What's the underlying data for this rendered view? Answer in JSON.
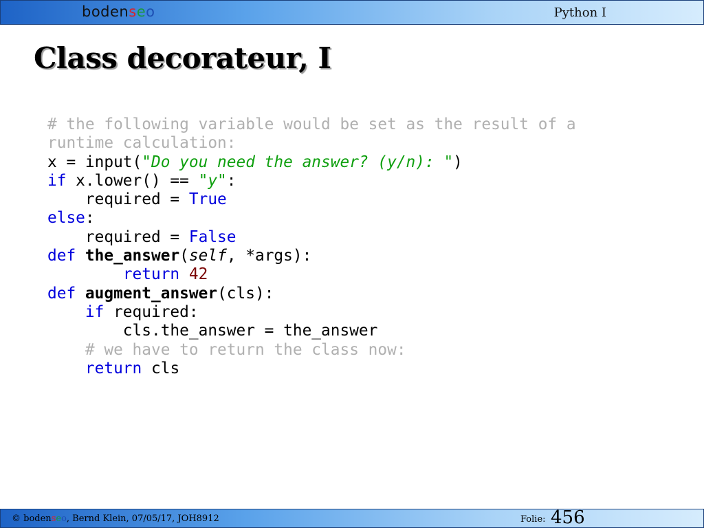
{
  "header": {
    "logo_text": "bodenseo",
    "course_title": "Python I"
  },
  "slide": {
    "title": "Class decorateur, I"
  },
  "code": {
    "comment_1a": "# the following variable would be set as the result of a",
    "comment_1b": "runtime calculation:",
    "line_x_prefix": "x = input(",
    "line_x_string": "\"Do you need the answer? (y/n): \"",
    "line_x_suffix": ")",
    "kw_if": "if",
    "line_if_middle": " x.lower() == ",
    "line_if_string": "\"y\"",
    "line_if_suffix": ":",
    "line_required_prefix": "    required = ",
    "kw_true": "True",
    "kw_else": "else",
    "colon": ":",
    "kw_false": "False",
    "kw_def": "def",
    "fn_the_answer": "the_answer",
    "paren_open": "(",
    "param_self": "self",
    "params_rest": ", *args):",
    "indent_return": "        ",
    "kw_return": "return",
    "num_42": "42",
    "fn_augment_answer": "augment_answer",
    "params_cls": "(cls):",
    "indent_4": "    ",
    "if_required_rest": " required:",
    "line_assign": "        cls.the_answer = the_answer",
    "comment_2": "    # we have to return the class now:",
    "return_cls_rest": " cls"
  },
  "footer": {
    "copyright_symbol": "©",
    "brand": "bodenseo",
    "credits": ", Bernd Klein, 07/05/17, JOH8912",
    "folie_label": "Folie:",
    "page_number": "456"
  },
  "colors": {
    "keyword": "#0000dd",
    "string": "#10a010",
    "number": "#7a0000",
    "comment": "#b0b0b0",
    "bar_dark": "#1e63c6",
    "bar_light": "#d6ecfd",
    "logo_red": "#d9232b",
    "logo_green": "#1a9a3a",
    "logo_blue": "#1d4fb3"
  }
}
